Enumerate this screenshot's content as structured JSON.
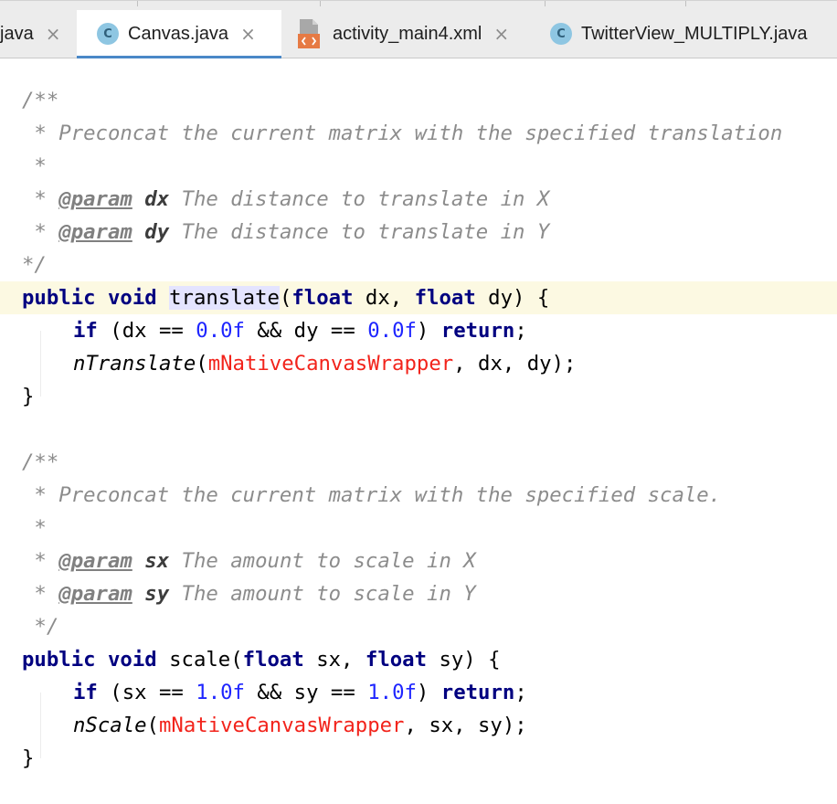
{
  "tabs": [
    {
      "label": "java",
      "icon": "",
      "active": false
    },
    {
      "label": "Canvas.java",
      "icon": "C",
      "active": true
    },
    {
      "label": "activity_main4.xml",
      "icon": "xml-file",
      "active": false
    },
    {
      "label": "TwitterView_MULTIPLY.java",
      "icon": "C",
      "active": false
    }
  ],
  "close_glyph": "×",
  "code": {
    "l1": "/**",
    "l2": " * Preconcat the current matrix with the specified translation",
    "l3": " *",
    "l4a": " * ",
    "l4tag": "@param",
    "l4p": "dx",
    "l4d": " The distance to translate in X",
    "l5a": " * ",
    "l5tag": "@param",
    "l5p": "dy",
    "l5d": " The distance to translate in Y",
    "l6": "*/",
    "l7kw": "public void",
    "l7name": "translate",
    "l7a": "(",
    "l7kw2": "float",
    "l7b": " dx, ",
    "l7kw3": "float",
    "l7c": " dy) {",
    "l8kw": "if",
    "l8a": " (dx == ",
    "l8n1": "0.0f",
    "l8b": " && dy == ",
    "l8n2": "0.0f",
    "l8c": ") ",
    "l8kw2": "return",
    "l8d": ";",
    "l9fn": "nTranslate",
    "l9a": "(",
    "l9f": "mNativeCanvasWrapper",
    "l9b": ", dx, dy);",
    "l10": "}",
    "l12": "/**",
    "l13": " * Preconcat the current matrix with the specified scale.",
    "l14": " *",
    "l15a": " * ",
    "l15tag": "@param",
    "l15p": "sx",
    "l15d": " The amount to scale in X",
    "l16a": " * ",
    "l16tag": "@param",
    "l16p": "sy",
    "l16d": " The amount to scale in Y",
    "l17": " */",
    "l18kw": "public void",
    "l18name": " scale",
    "l18a": "(",
    "l18kw2": "float",
    "l18b": " sx, ",
    "l18kw3": "float",
    "l18c": " sy) {",
    "l19kw": "if",
    "l19a": " (sx == ",
    "l19n1": "1.0f",
    "l19b": " && sy == ",
    "l19n2": "1.0f",
    "l19c": ") ",
    "l19kw2": "return",
    "l19d": ";",
    "l20fn": "nScale",
    "l20a": "(",
    "l20f": "mNativeCanvasWrapper",
    "l20b": ", sx, sy);",
    "l21": "}"
  }
}
